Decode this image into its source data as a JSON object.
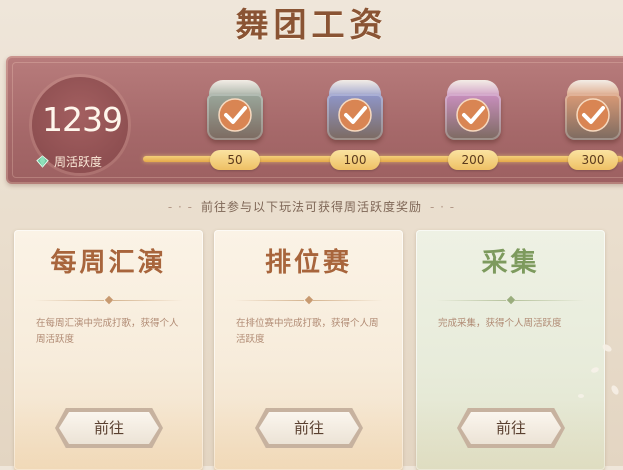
{
  "header": {
    "title": "舞团工资"
  },
  "progress": {
    "score": "1239",
    "score_label": "周活跃度",
    "milestones": [
      {
        "value": "50",
        "chest_color": "#9aa79b",
        "claimed": true
      },
      {
        "value": "100",
        "chest_color": "#8f96c9",
        "claimed": true
      },
      {
        "value": "200",
        "chest_color": "#c98fbe",
        "claimed": true
      },
      {
        "value": "300",
        "chest_color": "#d99a76",
        "claimed": true
      }
    ]
  },
  "hint": "前往参与以下玩法可获得周活跃度奖励",
  "activities": [
    {
      "title": "每周汇演",
      "desc": "在每周汇演中完成打歌，获得个人周活跃度",
      "button": "前往",
      "theme": "warm"
    },
    {
      "title": "排位赛",
      "desc": "在排位赛中完成打歌，获得个人周活跃度",
      "button": "前往",
      "theme": "warm"
    },
    {
      "title": "采集",
      "desc": "完成采集，获得个人周活跃度",
      "button": "前往",
      "theme": "green"
    }
  ],
  "colors": {
    "banner": "#a56869",
    "track": "#eec064",
    "title": "#8a5434"
  }
}
